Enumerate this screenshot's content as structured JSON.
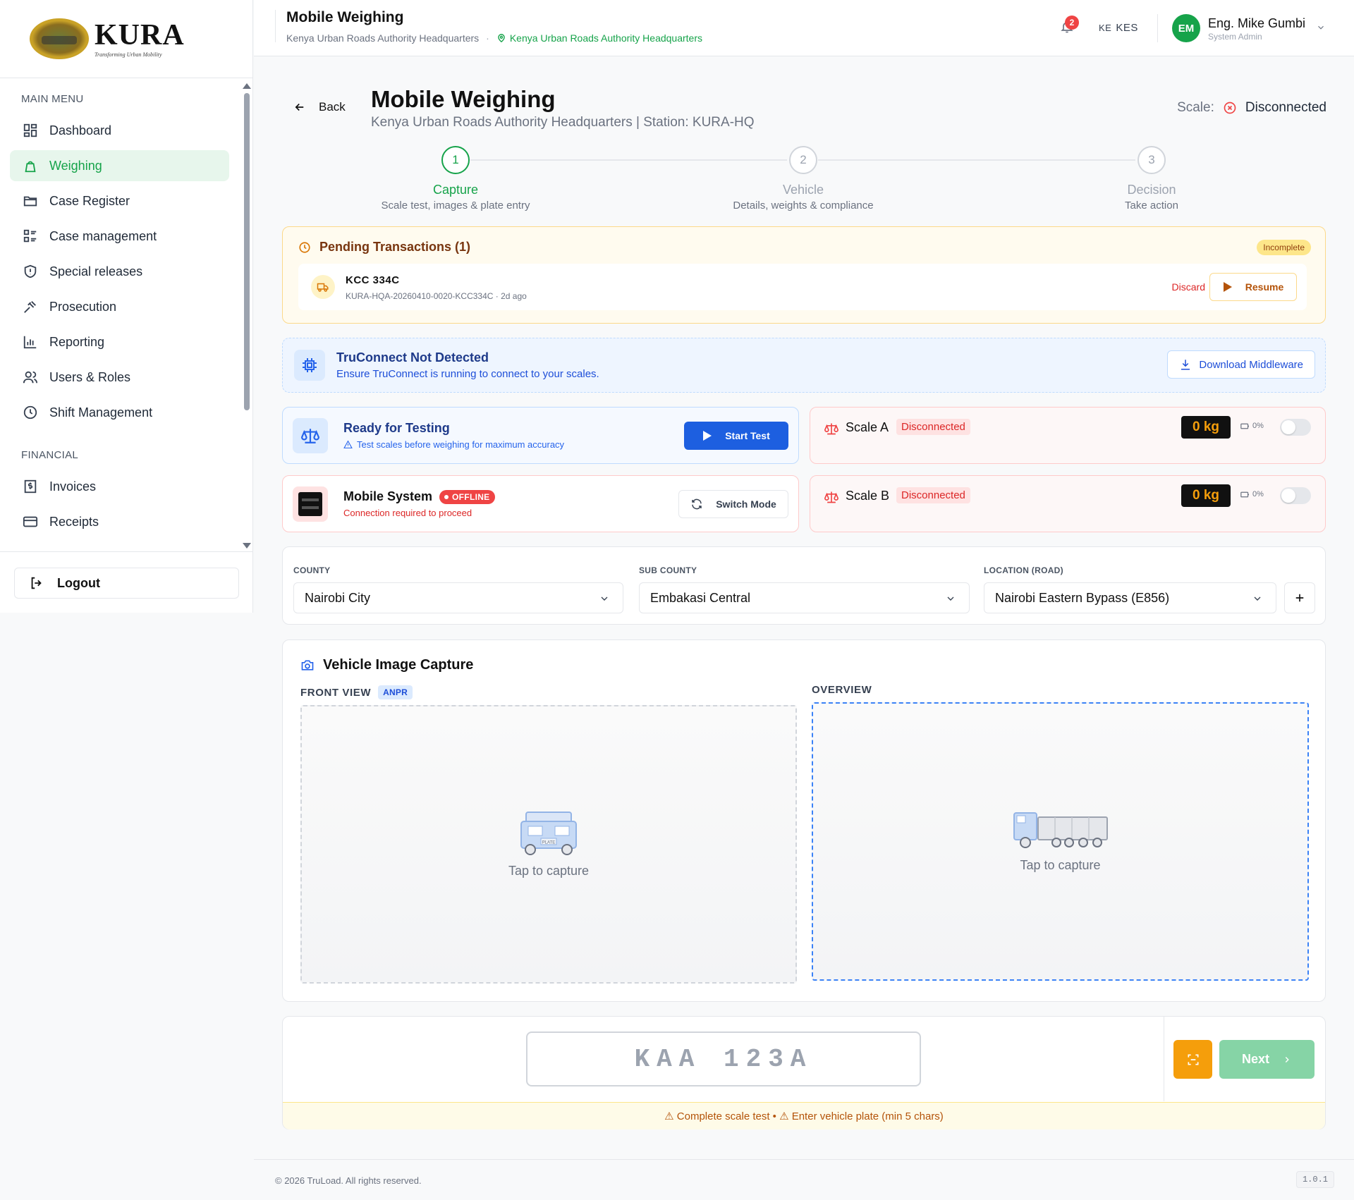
{
  "sidebar": {
    "logo_title": "KURA",
    "logo_subtitle": "Transforming Urban Mobility",
    "main_menu_label": "MAIN MENU",
    "items": [
      {
        "label": "Dashboard",
        "icon": "dashboard-icon"
      },
      {
        "label": "Weighing",
        "icon": "weighing-icon",
        "active": true
      },
      {
        "label": "Case Register",
        "icon": "folder-icon"
      },
      {
        "label": "Case management",
        "icon": "list-icon"
      },
      {
        "label": "Special releases",
        "icon": "shield-icon"
      },
      {
        "label": "Prosecution",
        "icon": "gavel-icon"
      },
      {
        "label": "Reporting",
        "icon": "chart-icon"
      },
      {
        "label": "Users & Roles",
        "icon": "users-icon"
      },
      {
        "label": "Shift Management",
        "icon": "clock-icon"
      }
    ],
    "financial_label": "FINANCIAL",
    "financial_items": [
      {
        "label": "Invoices",
        "icon": "invoice-icon"
      },
      {
        "label": "Receipts",
        "icon": "card-icon"
      }
    ],
    "logout_label": "Logout"
  },
  "topbar": {
    "title": "Mobile Weighing",
    "org": "Kenya Urban Roads Authority Headquarters",
    "location": "Kenya Urban Roads Authority Headquarters",
    "notification_count": "2",
    "currency_flag": "KE",
    "currency": "KES",
    "avatar_initials": "EM",
    "user_name": "Eng. Mike Gumbi",
    "user_role": "System Admin"
  },
  "header": {
    "back_label": "Back",
    "title": "Mobile Weighing",
    "subtitle": "Kenya Urban Roads Authority Headquarters | Station: KURA-HQ",
    "scale_label": "Scale:",
    "scale_status": "Disconnected"
  },
  "stepper": [
    {
      "num": "1",
      "label": "Capture",
      "desc": "Scale test, images & plate entry",
      "active": true
    },
    {
      "num": "2",
      "label": "Vehicle",
      "desc": "Details, weights & compliance",
      "active": false
    },
    {
      "num": "3",
      "label": "Decision",
      "desc": "Take action",
      "active": false
    }
  ],
  "pending": {
    "title": "Pending Transactions (1)",
    "badge": "Incomplete",
    "plate": "KCC 334C",
    "txn": "KURA-HQA-20260410-0020-KCC334C · 2d ago",
    "discard_label": "Discard",
    "resume_label": "Resume"
  },
  "truconnect": {
    "title": "TruConnect Not Detected",
    "subtitle": "Ensure TruConnect is running to connect to your scales.",
    "download_label": "Download Middleware"
  },
  "testing": {
    "title": "Ready for Testing",
    "subtitle": "Test scales before weighing for maximum accuracy",
    "button": "Start Test"
  },
  "mobile_system": {
    "title": "Mobile System",
    "badge": "OFFLINE",
    "subtitle": "Connection required to proceed",
    "button": "Switch Mode"
  },
  "scales": [
    {
      "name": "Scale A",
      "status": "Disconnected",
      "reading": "0 kg",
      "battery": "0%",
      "enabled": false
    },
    {
      "name": "Scale B",
      "status": "Disconnected",
      "reading": "0 kg",
      "battery": "0%",
      "enabled": false
    }
  ],
  "location": {
    "county_label": "COUNTY",
    "county": "Nairobi City",
    "subcounty_label": "SUB COUNTY",
    "subcounty": "Embakasi Central",
    "road_label": "LOCATION (ROAD)",
    "road": "Nairobi Eastern Bypass (E856)"
  },
  "image_capture": {
    "title": "Vehicle Image Capture",
    "front_label": "FRONT VIEW",
    "front_badge": "ANPR",
    "front_plate_text": "PLATE",
    "front_cta": "Tap to capture",
    "overview_label": "OVERVIEW",
    "overview_cta": "Tap to capture"
  },
  "plate_entry": {
    "placeholder": "KAA 123A",
    "next_label": "Next",
    "warning": "⚠ Complete scale test • ⚠ Enter vehicle plate (min 5 chars)"
  },
  "footer": {
    "copyright": "© 2026 TruLoad. All rights reserved.",
    "version": "1.0.1"
  },
  "colors": {
    "brand_green": "#16a34a",
    "primary_blue": "#1d5fe0",
    "danger": "#dc2626",
    "warning": "#f59e0b"
  }
}
